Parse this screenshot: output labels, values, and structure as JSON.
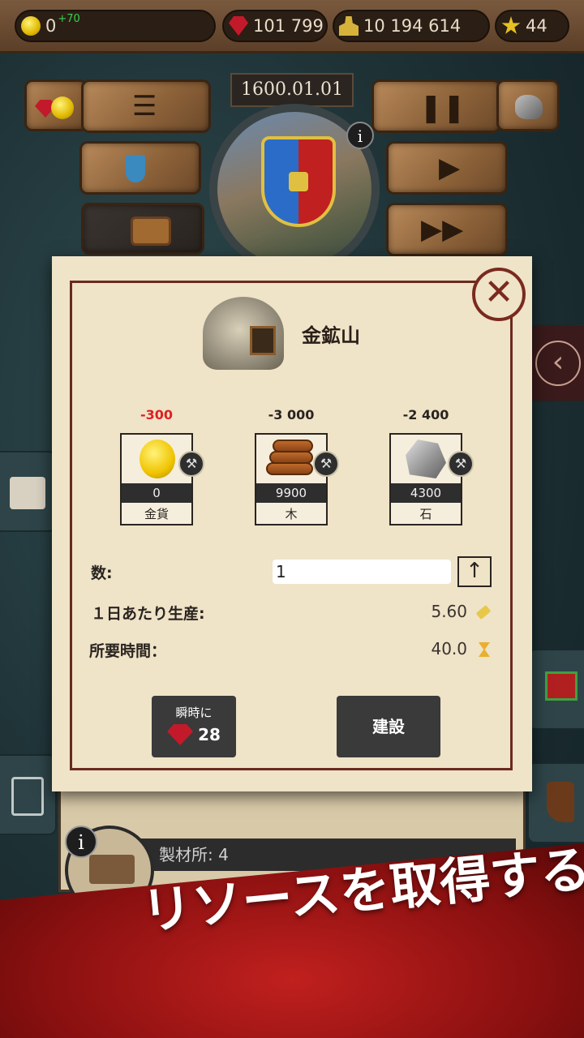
{
  "topbar": {
    "gold": "0",
    "gold_income": "+70",
    "gems": "101 799",
    "population": "10 194 614",
    "stars": "44"
  },
  "header": {
    "date": "1600.01.01",
    "info_glyph": "i"
  },
  "dialog": {
    "title": "金鉱山",
    "close_glyph": "✕",
    "costs": [
      {
        "amount": "-300",
        "stock": "0",
        "name": "金貨",
        "insufficient": true
      },
      {
        "amount": "-3 000",
        "stock": "9900",
        "name": "木",
        "insufficient": false
      },
      {
        "amount": "-2 400",
        "stock": "4300",
        "name": "石",
        "insufficient": false
      }
    ],
    "quantity_label": "数:",
    "quantity_value": "1",
    "production_label": "１日あたり生産:",
    "production_value": "5.60",
    "time_label": "所要時間：",
    "time_value": "40.0",
    "instant_label": "瞬時に",
    "instant_cost": "28",
    "build_label": "建設"
  },
  "background": {
    "sawmill_label": "製材所: 4",
    "info_glyph": "i"
  },
  "banner": {
    "text": "リソースを取得する"
  },
  "colors": {
    "insufficient": "#e02020",
    "banner": "#c0201e",
    "dialog_border": "#6a2a1e"
  }
}
